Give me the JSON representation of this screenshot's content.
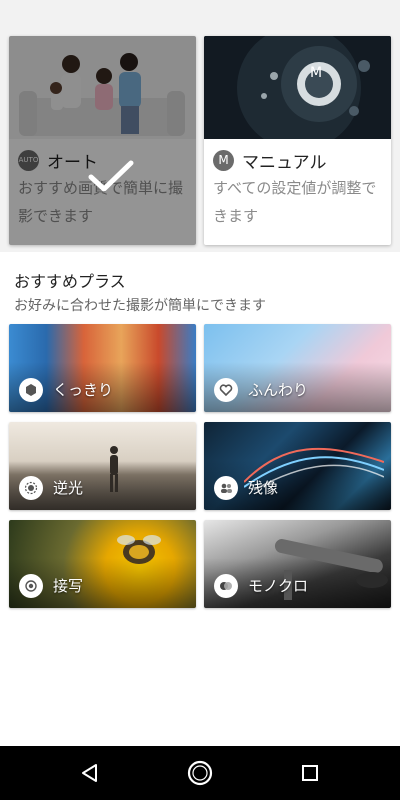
{
  "modes": {
    "auto": {
      "badge": "AUTO",
      "title": "オート",
      "desc": "おすすめ画質で簡単に撮影できます",
      "photo_icon": "family-photo",
      "selected": true
    },
    "manual": {
      "badge": "M",
      "title": "マニュアル",
      "desc": "すべての設定値が調整できます",
      "photo_icon": "camera-dial-photo"
    }
  },
  "section": {
    "title": "おすすめプラス",
    "subtitle": "お好みに合わせた撮影が簡単にできます"
  },
  "scenes": [
    {
      "label": "くっきり",
      "icon": "vivid-icon"
    },
    {
      "label": "ふんわり",
      "icon": "heart-icon"
    },
    {
      "label": "逆光",
      "icon": "backlight-icon"
    },
    {
      "label": "残像",
      "icon": "people-trail-icon"
    },
    {
      "label": "接写",
      "icon": "macro-icon"
    },
    {
      "label": "モノクロ",
      "icon": "monochrome-icon"
    }
  ],
  "nav": {
    "back_icon": "back-triangle-icon",
    "home_icon": "home-circle-icon",
    "recent_icon": "recent-square-icon"
  }
}
